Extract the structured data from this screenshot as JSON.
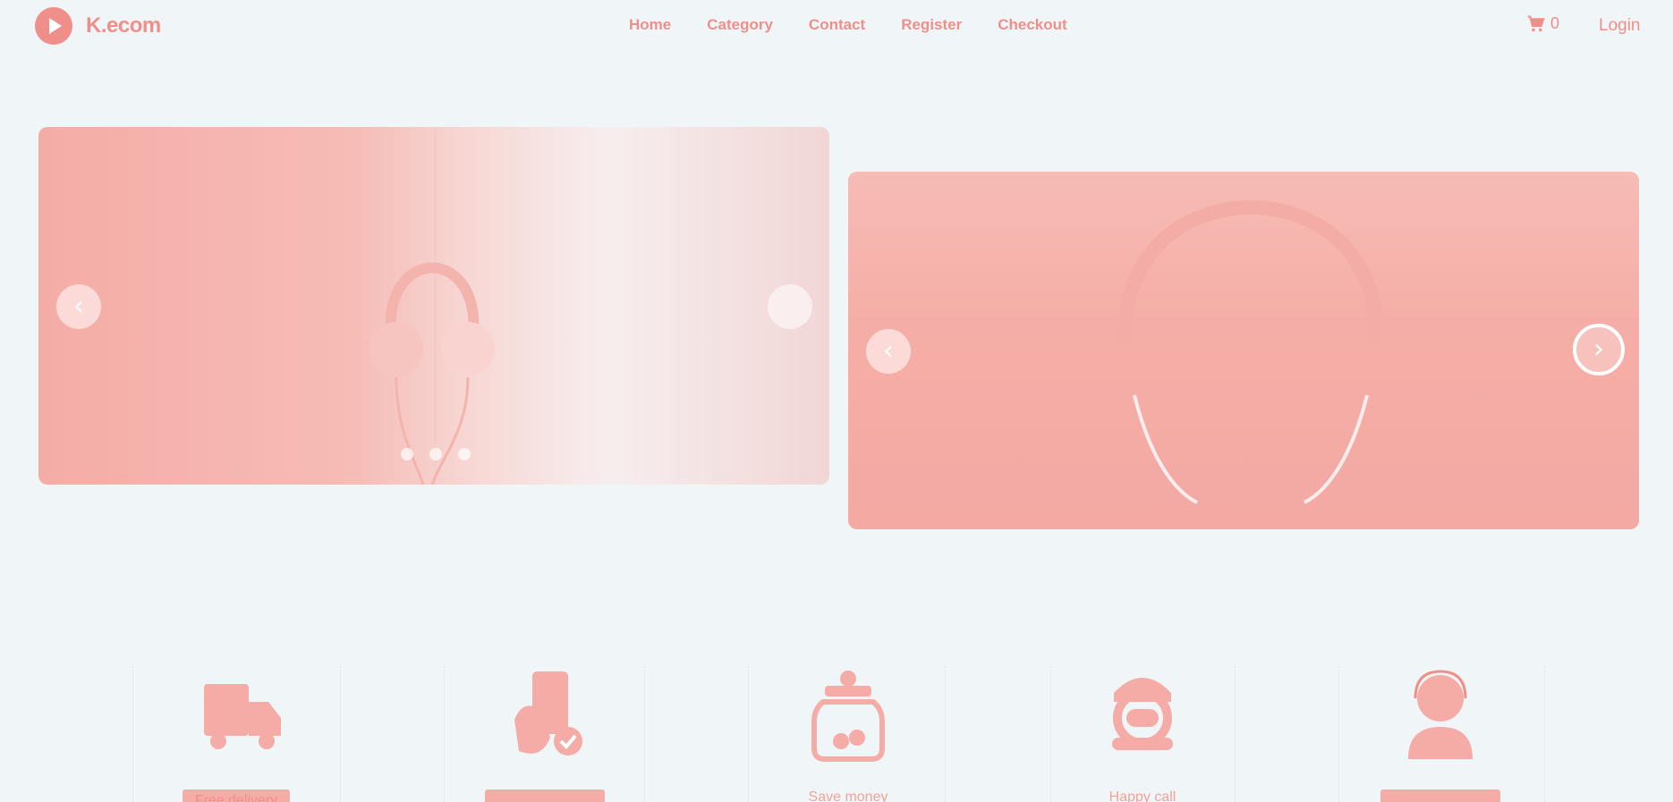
{
  "brand": {
    "name": "K.ecom",
    "icon": "play-logo-icon"
  },
  "nav": {
    "items": [
      {
        "label": "Home"
      },
      {
        "label": "Category"
      },
      {
        "label": "Contact"
      },
      {
        "label": "Register"
      },
      {
        "label": "Checkout"
      }
    ],
    "cart_count": "0",
    "login_label": "Login"
  },
  "colors": {
    "accent": "#f08f8a",
    "accent_light": "#f5aca6",
    "background": "#f0f6f8"
  },
  "carousel": {
    "slides": [
      {
        "image": "white-headphones-photo",
        "prev_icon": "chevron-left-icon",
        "next_icon": "chevron-right-icon",
        "indicator_count": 3
      },
      {
        "image": "headphones-photo",
        "prev_icon": "chevron-left-icon",
        "next_icon": "chevron-right-icon"
      }
    ]
  },
  "features": [
    {
      "icon": "delivery-truck-icon",
      "label": "Free delivery"
    },
    {
      "icon": "secure-payment-icon",
      "label": ""
    },
    {
      "icon": "savings-jar-icon",
      "label": "Save money"
    },
    {
      "icon": "call-center-icon",
      "label": "Happy call"
    },
    {
      "icon": "customer-support-icon",
      "label": ""
    }
  ]
}
